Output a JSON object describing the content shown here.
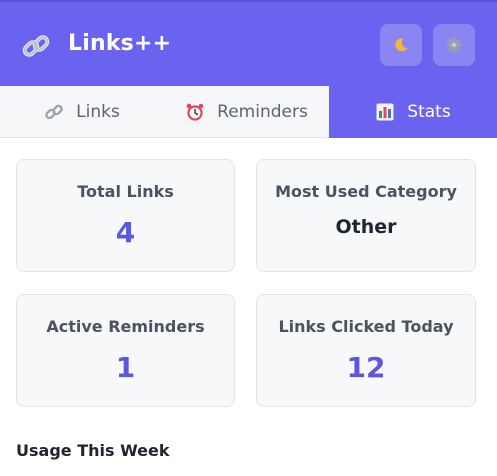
{
  "header": {
    "title": "Links++",
    "logo_icon": "link-icon",
    "theme_button_icon": "moon-icon",
    "settings_button_icon": "gear-icon"
  },
  "tabs": [
    {
      "label": "Links",
      "icon": "link-icon",
      "active": false
    },
    {
      "label": "Reminders",
      "icon": "alarm-clock-icon",
      "active": false
    },
    {
      "label": "Stats",
      "icon": "bar-chart-icon",
      "active": true
    }
  ],
  "stats": {
    "total_links": {
      "label": "Total Links",
      "value": "4"
    },
    "most_used_category": {
      "label": "Most Used Category",
      "value": "Other"
    },
    "active_reminders": {
      "label": "Active Reminders",
      "value": "1"
    },
    "links_clicked_today": {
      "label": "Links Clicked Today",
      "value": "12"
    }
  },
  "usage": {
    "title": "Usage This Week"
  },
  "colors": {
    "accent": "#6b63f0",
    "value": "#5b57e0",
    "card_bg": "#f7f8fa"
  }
}
